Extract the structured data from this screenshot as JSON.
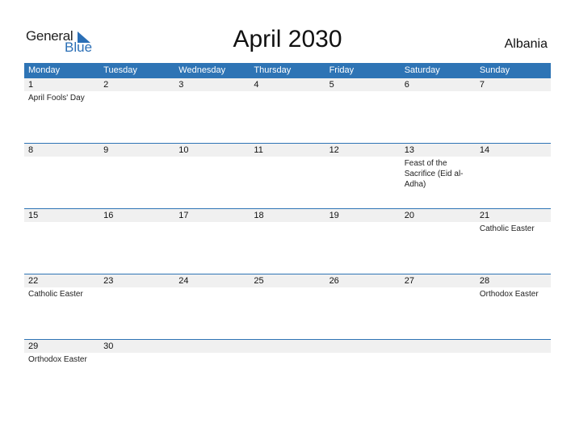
{
  "logo": {
    "general": "General",
    "blue": "Blue"
  },
  "title": "April 2030",
  "country": "Albania",
  "days": [
    "Monday",
    "Tuesday",
    "Wednesday",
    "Thursday",
    "Friday",
    "Saturday",
    "Sunday"
  ],
  "weeks": [
    {
      "nums": [
        "1",
        "2",
        "3",
        "4",
        "5",
        "6",
        "7"
      ],
      "events": [
        "April Fools' Day",
        "",
        "",
        "",
        "",
        "",
        ""
      ]
    },
    {
      "nums": [
        "8",
        "9",
        "10",
        "11",
        "12",
        "13",
        "14"
      ],
      "events": [
        "",
        "",
        "",
        "",
        "",
        "Feast of the Sacrifice (Eid al-Adha)",
        ""
      ]
    },
    {
      "nums": [
        "15",
        "16",
        "17",
        "18",
        "19",
        "20",
        "21"
      ],
      "events": [
        "",
        "",
        "",
        "",
        "",
        "",
        "Catholic Easter"
      ]
    },
    {
      "nums": [
        "22",
        "23",
        "24",
        "25",
        "26",
        "27",
        "28"
      ],
      "events": [
        "Catholic Easter",
        "",
        "",
        "",
        "",
        "",
        "Orthodox Easter"
      ]
    },
    {
      "nums": [
        "29",
        "30",
        "",
        "",
        "",
        "",
        ""
      ],
      "events": [
        "Orthodox Easter",
        "",
        "",
        "",
        "",
        "",
        ""
      ]
    }
  ]
}
